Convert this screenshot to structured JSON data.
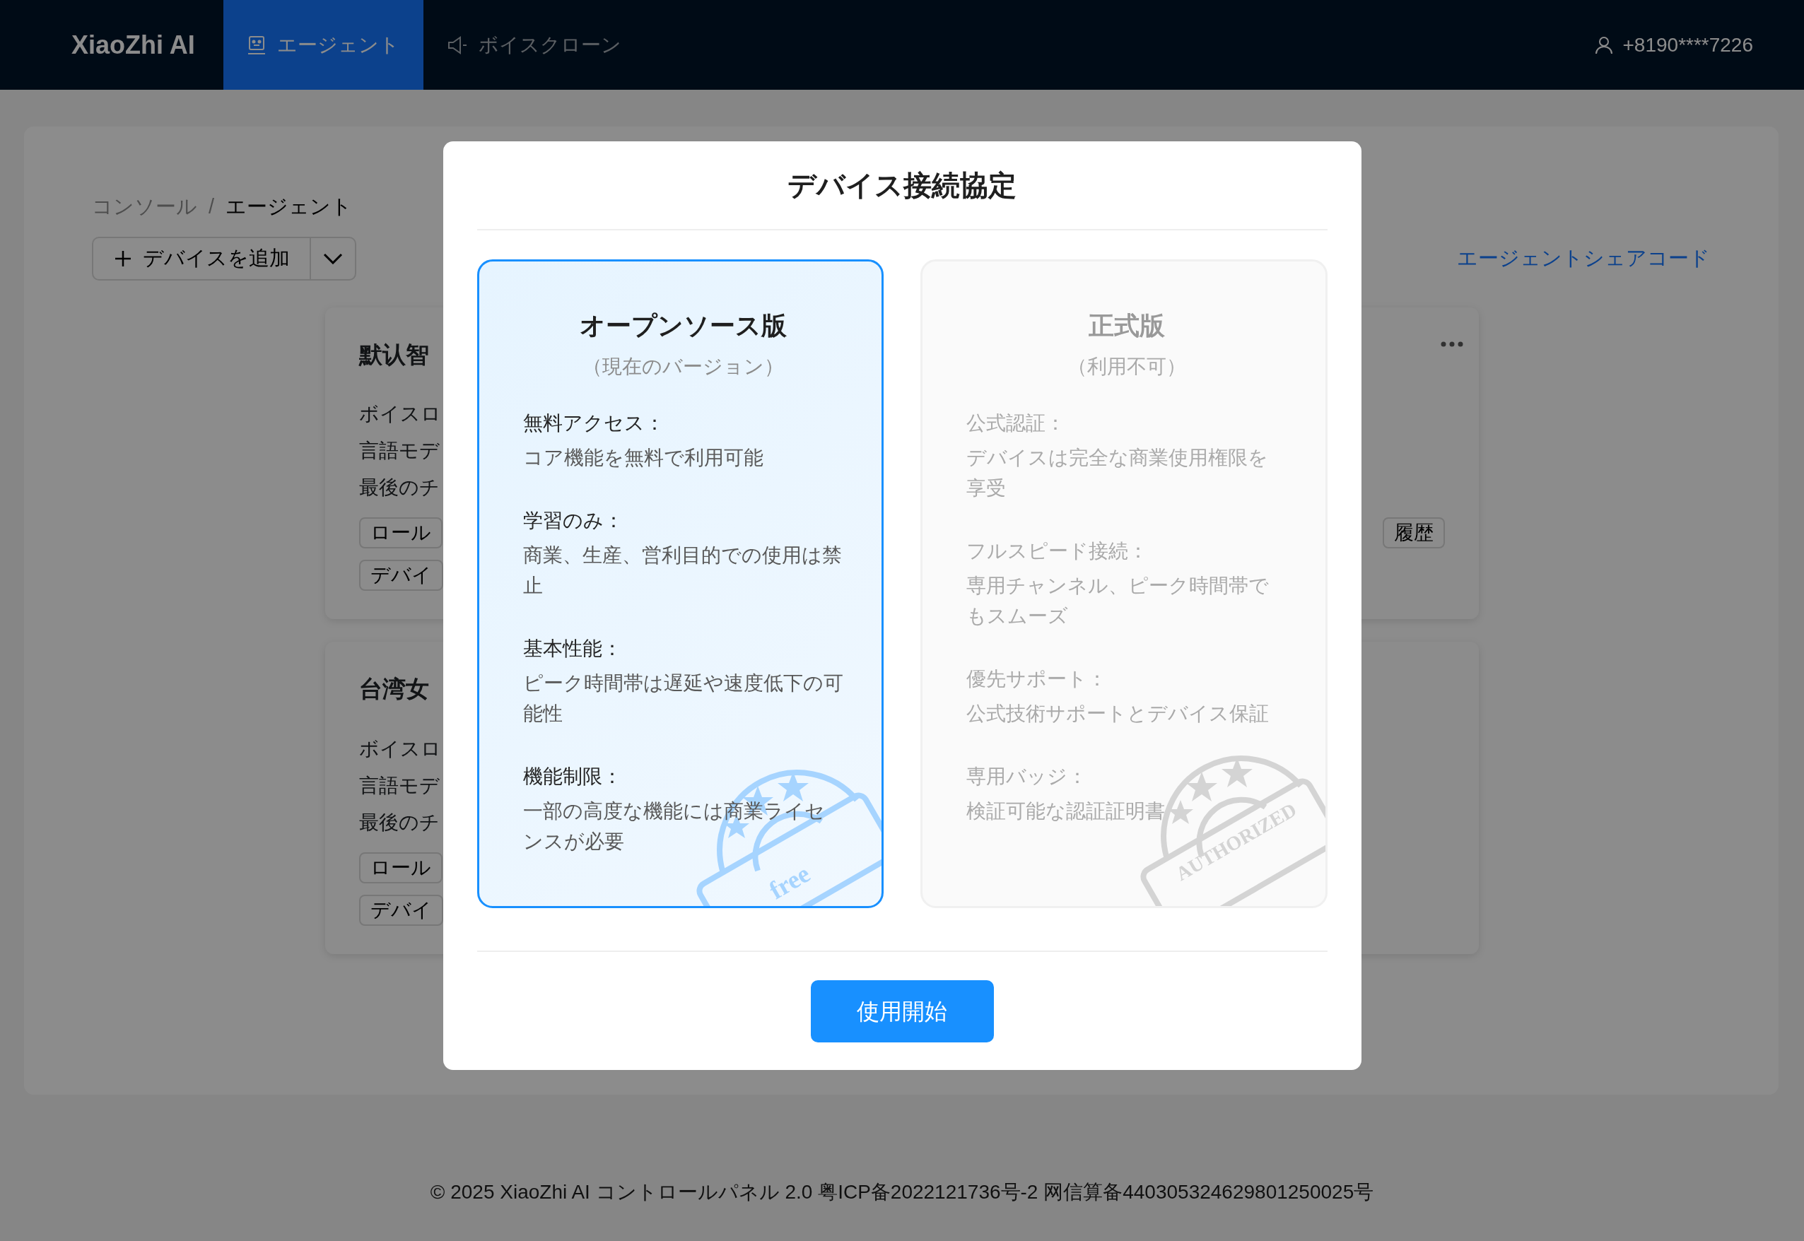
{
  "header": {
    "logo": "XiaoZhi AI",
    "tabs": [
      {
        "label": "エージェント",
        "kind": "agent",
        "selected": true
      },
      {
        "label": "ボイスクローン",
        "kind": "voice",
        "selected": false
      }
    ],
    "user": "+8190****7226"
  },
  "breadcrumb": [
    "コンソール",
    "エージェント"
  ],
  "breadcrumb_separator": "/",
  "add_device_button": "デバイスを追加",
  "share_code_link": "エージェントシェアコード",
  "agent_cards": [
    {
      "title": "默认智",
      "lines": [
        "ボイスロ",
        "言語モデ",
        "最後のチ"
      ],
      "buttons": [
        "ロール",
        "デバイ"
      ],
      "right_button": "履歴",
      "menu": true
    },
    {
      "title": "台湾女",
      "lines": [
        "ボイスロ",
        "言語モデ",
        "最後のチ"
      ],
      "buttons": [
        "ロール",
        "デバイ"
      ],
      "menu": false
    }
  ],
  "modal": {
    "title": "デバイス接続協定",
    "plans": [
      {
        "title": "オープンソース版",
        "subtitle": "（現在のバージョン）",
        "selected": true,
        "disabled": false,
        "stamp": "free",
        "features": [
          {
            "label": "無料アクセス：",
            "text": "コア機能を無料で利用可能"
          },
          {
            "label": "学習のみ：",
            "text": "商業、生産、営利目的での使用は禁止"
          },
          {
            "label": "基本性能：",
            "text": "ピーク時間帯は遅延や速度低下の可能性"
          },
          {
            "label": "機能制限：",
            "text": "一部の高度な機能には商業ライセンスが必要"
          }
        ]
      },
      {
        "title": "正式版",
        "subtitle": "（利用不可）",
        "selected": false,
        "disabled": true,
        "stamp": "AUTHORIZED",
        "features": [
          {
            "label": "公式認証：",
            "text": "デバイスは完全な商業使用権限を享受"
          },
          {
            "label": "フルスピード接続：",
            "text": "専用チャンネル、ピーク時間帯でもスムーズ"
          },
          {
            "label": "優先サポート：",
            "text": "公式技術サポートとデバイス保証"
          },
          {
            "label": "専用バッジ：",
            "text": "検証可能な認証証明書"
          }
        ]
      }
    ],
    "button": "使用開始"
  },
  "footer": "© 2025 XiaoZhi AI コントロールパネル 2.0 粤ICP备2022121736号-2 网信算备440305324629801250025号"
}
